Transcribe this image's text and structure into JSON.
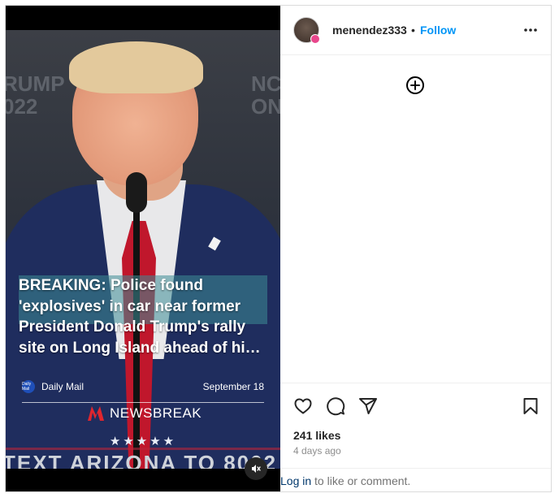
{
  "post": {
    "username": "menendez333",
    "separator": "•",
    "follow_label": "Follow",
    "likes": "241 likes",
    "time_ago": "4 days ago",
    "login_link": "Log in",
    "login_suffix": " to like or comment."
  },
  "video": {
    "bg_text_left": "RUMP\n022",
    "bg_text_right": "NC\nON",
    "headline": "BREAKING: Police found 'explosives' in car near former President Donald Trump's rally site on Long Island ahead of hi…",
    "source_name": "Daily Mail",
    "source_logo_text": "Daily Mail",
    "source_date": "September 18",
    "brand_name": "NEWSBREAK",
    "stars": "★★★★★",
    "bottom_text": "TEXT ARIZONA TO 8002"
  },
  "colors": {
    "follow": "#0095f6",
    "brand_red": "#e0262e",
    "avatar_badge": "#e8468b"
  },
  "icons": [
    "more-options-icon",
    "add-circle-icon",
    "heart-icon",
    "comment-icon",
    "share-icon",
    "bookmark-icon",
    "mute-icon",
    "verified-badge-icon",
    "newsbreak-logo-icon"
  ]
}
